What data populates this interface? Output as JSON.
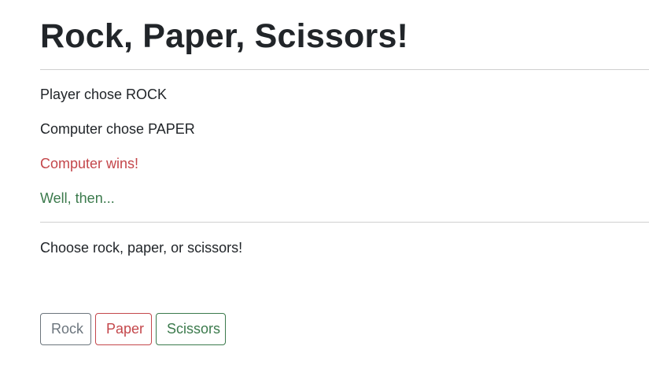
{
  "page": {
    "title": "Rock, Paper, Scissors!"
  },
  "results": {
    "player_choice": "Player chose ROCK",
    "computer_choice": "Computer chose PAPER",
    "outcome": "Computer wins!",
    "comment": "Well, then..."
  },
  "prompt": {
    "text": "Choose rock, paper, or scissors!"
  },
  "buttons": {
    "rock": "Rock",
    "paper": "Paper",
    "scissors": "Scissors"
  },
  "colors": {
    "text": "#212529",
    "danger": "#c4474b",
    "success": "#3b7a4c",
    "secondary": "#6c757d",
    "divider": "#cfcfcf"
  }
}
